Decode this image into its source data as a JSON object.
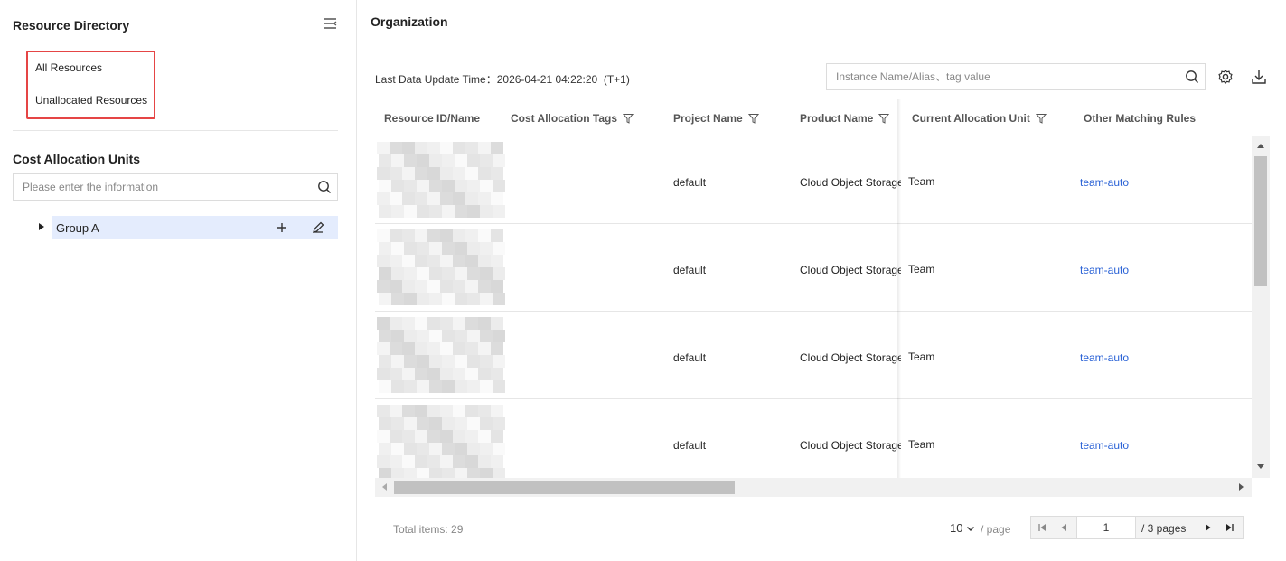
{
  "sidebar": {
    "title": "Resource Directory",
    "resource_items": [
      "All Resources",
      "Unallocated Resources"
    ],
    "cost_units_title": "Cost Allocation Units",
    "search_placeholder": "Please enter the information",
    "tree": [
      {
        "label": "Group A"
      }
    ]
  },
  "main": {
    "title": "Organization",
    "update_time_label": "Last Data Update Time：",
    "update_time_value": "2026-04-21 04:22:20",
    "update_time_note": "(T+1)",
    "search_placeholder": "Instance Name/Alias、tag value",
    "columns": [
      {
        "label": "Resource ID/Name",
        "filter": false
      },
      {
        "label": "Cost Allocation Tags",
        "filter": true
      },
      {
        "label": "Project Name",
        "filter": true
      },
      {
        "label": "Product Name",
        "filter": true
      },
      {
        "label": "Current Allocation Unit",
        "filter": true
      },
      {
        "label": "Other Matching Rules",
        "filter": false
      }
    ],
    "rows": [
      {
        "project": "default",
        "product": "Cloud Object Storage",
        "unit": "Team",
        "rule": "team-auto"
      },
      {
        "project": "default",
        "product": "Cloud Object Storage",
        "unit": "Team",
        "rule": "team-auto"
      },
      {
        "project": "default",
        "product": "Cloud Object Storage",
        "unit": "Team",
        "rule": "team-auto"
      },
      {
        "project": "default",
        "product": "Cloud Object Storage",
        "unit": "Team",
        "rule": "team-auto"
      }
    ]
  },
  "pagination": {
    "total": "Total items: 29",
    "page_size": "10",
    "per_page": "/ page",
    "current_page": "1",
    "total_pages": "/ 3 pages"
  },
  "colors": {
    "accent": "#2a62d6",
    "highlight_border": "#e54545",
    "tree_selected_bg": "#e4ecfd"
  },
  "icons": [
    "collapse-menu-icon",
    "search-icon",
    "caret-right-icon",
    "plus-icon",
    "pencil-icon",
    "filter-icon",
    "gear-icon",
    "download-icon",
    "chevron-down-icon",
    "first-page-icon",
    "prev-page-icon",
    "next-page-icon",
    "last-page-icon"
  ]
}
